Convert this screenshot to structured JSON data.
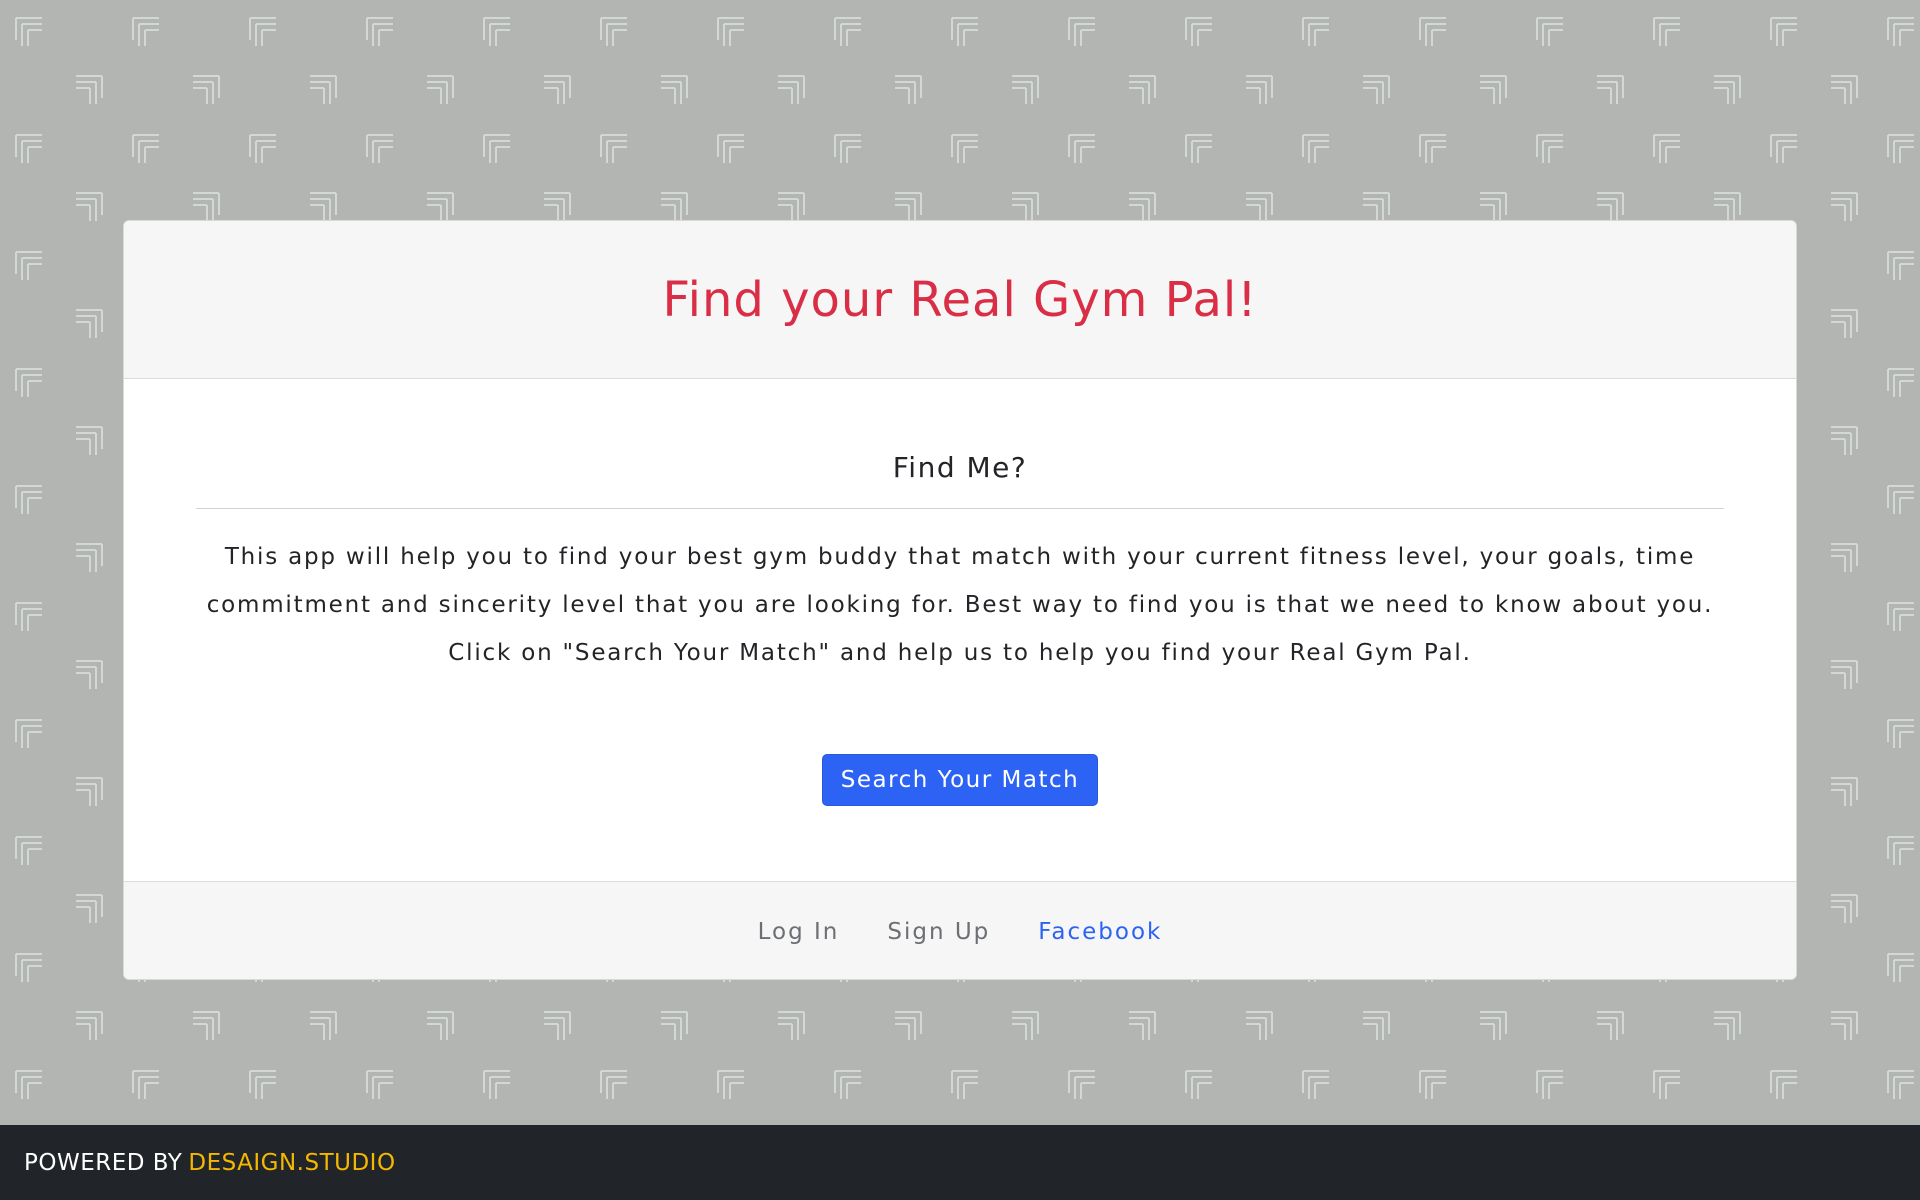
{
  "header": {
    "title": "Find your Real Gym Pal!"
  },
  "main": {
    "subtitle": "Find Me?",
    "description": "This app will help you to find your best gym buddy that match with your current fitness level, your goals, time commitment and sincerity level that you are looking for. Best way to find you is that we need to know about you. Click on \"Search Your Match\" and help us to help you find your Real Gym Pal.",
    "search_button_label": "Search Your Match"
  },
  "footer": {
    "links": [
      {
        "label": "Log In"
      },
      {
        "label": "Sign Up"
      },
      {
        "label": "Facebook"
      }
    ]
  },
  "powered_by": {
    "label": "POWERED BY",
    "brand": "DESAIGN.STUDIO"
  },
  "colors": {
    "title": "#d92e45",
    "accent": "#2d63f5",
    "brand": "#f5b800",
    "bottom_bar": "#212428",
    "background": "#b2b5b1"
  }
}
